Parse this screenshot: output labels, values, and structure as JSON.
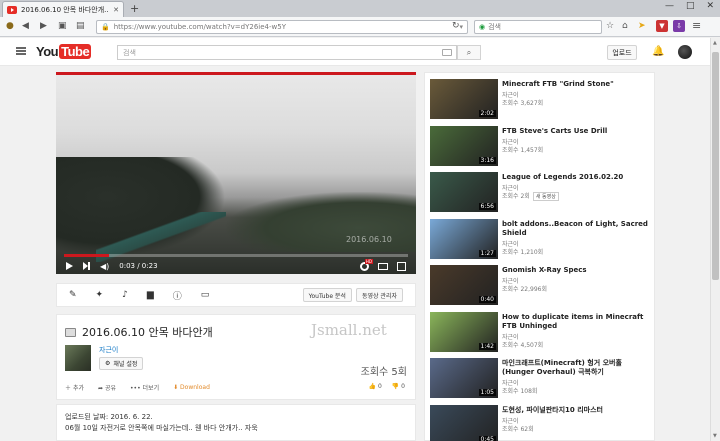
{
  "browser": {
    "tab_title": "2016.06.10 안목 바다안개...",
    "url": "https://www.youtube.com/watch?v=dY26ie4-w5Y",
    "search_placeholder": "검색",
    "new_tab": "+",
    "close": "✕"
  },
  "header": {
    "logo_you": "You",
    "logo_tube": "Tube",
    "search_placeholder": "검색",
    "upload_label": "업로드"
  },
  "player": {
    "time": "0:03 / 0:23",
    "watermark": "2016.06.10",
    "progress": 0.13
  },
  "actions": {
    "analytics_label": "YouTube 분석",
    "manager_label": "동영상 관리자"
  },
  "video": {
    "title": "2016.06.10 안목 바다안개",
    "overlay_text": "Jsmall.net",
    "channel_name": "자근이",
    "channel_settings_label": "채널 설정",
    "views": "조회수 5회",
    "add_label": "추가",
    "share_label": "공유",
    "more_label": "더보기",
    "download_label": "Download",
    "likes": "0",
    "dislikes": "0"
  },
  "description": {
    "published": "업로드된 날짜: 2016. 6. 22.",
    "text": "06월 10일 자전거로 안목쪽에 마실가는데.. 웬 바다 안개가.. 자욱"
  },
  "sidebar": {
    "items": [
      {
        "title": "Minecraft FTB \"Grind Stone\"",
        "channel": "자근이",
        "views": "조회수 3,627회",
        "duration": "2:02",
        "color": "#6a5a3a"
      },
      {
        "title": "FTB Steve's Carts Use Drill",
        "channel": "자근이",
        "views": "조회수 1,457회",
        "duration": "3:16",
        "color": "#4a6b3a"
      },
      {
        "title": "League of Legends 2016.02.20",
        "channel": "자근이",
        "views": "조회수 2회",
        "badge": "새 동영상",
        "duration": "6:56",
        "color": "#3a5a4a"
      },
      {
        "title": "bolt addons..Beacon of Light, Sacred Shield",
        "channel": "자근이",
        "views": "조회수 1,210회",
        "duration": "1:27",
        "color": "#7aa9d8"
      },
      {
        "title": "Gnomish X-Ray Specs",
        "channel": "자근이",
        "views": "조회수 22,996회",
        "duration": "0:40",
        "color": "#4a3a2a"
      },
      {
        "title": "How to duplicate items in Minecraft FTB Unhinged",
        "channel": "자근이",
        "views": "조회수 4,507회",
        "duration": "1:42",
        "color": "#8ab55a"
      },
      {
        "title": "마인크래프트(Minecraft) 헝거 오버홀 (Hunger Overhaul) 극복하기",
        "channel": "자근이",
        "views": "조회수 108회",
        "duration": "1:05",
        "color": "#5a6a8a"
      },
      {
        "title": "도현성, 파이널판타지10 리마스터",
        "channel": "자근이",
        "views": "조회수 62회",
        "duration": "0:45",
        "color": "#3a4a5a"
      }
    ]
  }
}
